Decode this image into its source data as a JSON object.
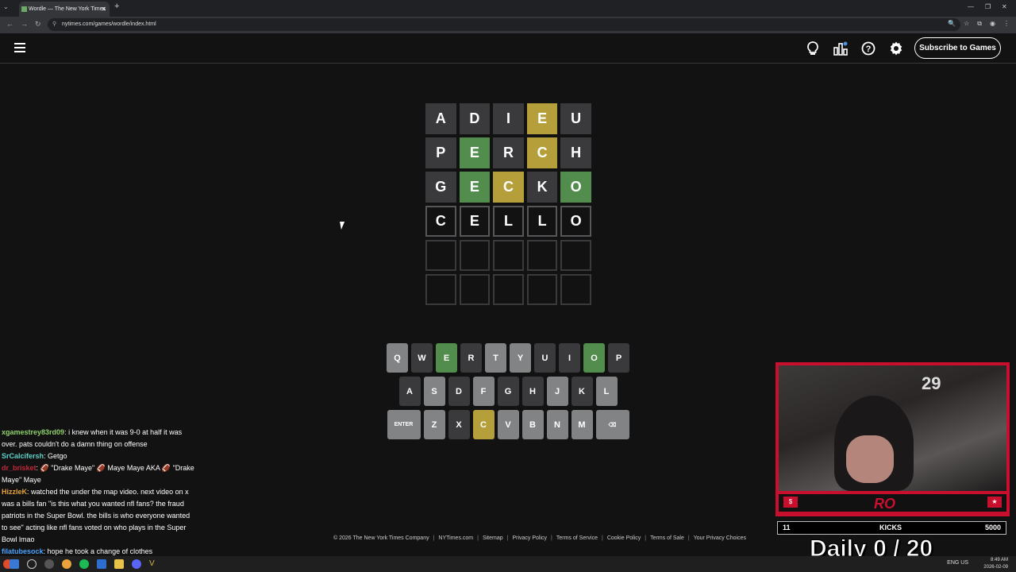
{
  "browser": {
    "tab_title": "Wordle — The New York Times",
    "url": "nytimes.com/games/wordle/index.html"
  },
  "header": {
    "subscribe_label": "Subscribe to Games",
    "icons": [
      "menu-icon",
      "hint-bulb-icon",
      "stats-icon",
      "help-icon",
      "settings-icon"
    ]
  },
  "board": {
    "rows": [
      [
        {
          "l": "A",
          "s": "absent"
        },
        {
          "l": "D",
          "s": "absent"
        },
        {
          "l": "I",
          "s": "absent"
        },
        {
          "l": "E",
          "s": "present"
        },
        {
          "l": "U",
          "s": "absent"
        }
      ],
      [
        {
          "l": "P",
          "s": "absent"
        },
        {
          "l": "E",
          "s": "correct"
        },
        {
          "l": "R",
          "s": "absent"
        },
        {
          "l": "C",
          "s": "present"
        },
        {
          "l": "H",
          "s": "absent"
        }
      ],
      [
        {
          "l": "G",
          "s": "absent"
        },
        {
          "l": "E",
          "s": "correct"
        },
        {
          "l": "C",
          "s": "present"
        },
        {
          "l": "K",
          "s": "absent"
        },
        {
          "l": "O",
          "s": "correct"
        }
      ],
      [
        {
          "l": "C",
          "s": "tbd"
        },
        {
          "l": "E",
          "s": "tbd"
        },
        {
          "l": "L",
          "s": "tbd"
        },
        {
          "l": "L",
          "s": "tbd"
        },
        {
          "l": "O",
          "s": "tbd"
        }
      ],
      [
        {
          "l": "",
          "s": "empty"
        },
        {
          "l": "",
          "s": "empty"
        },
        {
          "l": "",
          "s": "empty"
        },
        {
          "l": "",
          "s": "empty"
        },
        {
          "l": "",
          "s": "empty"
        }
      ],
      [
        {
          "l": "",
          "s": "empty"
        },
        {
          "l": "",
          "s": "empty"
        },
        {
          "l": "",
          "s": "empty"
        },
        {
          "l": "",
          "s": "empty"
        },
        {
          "l": "",
          "s": "empty"
        }
      ]
    ]
  },
  "keyboard": {
    "rows": [
      [
        {
          "k": "Q",
          "s": "unused"
        },
        {
          "k": "W",
          "s": "absent"
        },
        {
          "k": "E",
          "s": "correct"
        },
        {
          "k": "R",
          "s": "absent"
        },
        {
          "k": "T",
          "s": "unused"
        },
        {
          "k": "Y",
          "s": "unused"
        },
        {
          "k": "U",
          "s": "absent"
        },
        {
          "k": "I",
          "s": "absent"
        },
        {
          "k": "O",
          "s": "correct"
        },
        {
          "k": "P",
          "s": "absent"
        }
      ],
      [
        {
          "k": "A",
          "s": "absent"
        },
        {
          "k": "S",
          "s": "unused"
        },
        {
          "k": "D",
          "s": "absent"
        },
        {
          "k": "F",
          "s": "unused"
        },
        {
          "k": "G",
          "s": "absent"
        },
        {
          "k": "H",
          "s": "absent"
        },
        {
          "k": "J",
          "s": "unused"
        },
        {
          "k": "K",
          "s": "absent"
        },
        {
          "k": "L",
          "s": "unused"
        }
      ],
      [
        {
          "k": "ENTER",
          "s": "unused",
          "wide": true
        },
        {
          "k": "Z",
          "s": "unused"
        },
        {
          "k": "X",
          "s": "absent"
        },
        {
          "k": "C",
          "s": "present"
        },
        {
          "k": "V",
          "s": "unused"
        },
        {
          "k": "B",
          "s": "unused"
        },
        {
          "k": "N",
          "s": "unused"
        },
        {
          "k": "M",
          "s": "unused"
        },
        {
          "k": "⌫",
          "s": "unused",
          "wide": true
        }
      ]
    ]
  },
  "footer": [
    "© 2026 The New York Times Company",
    "NYTimes.com",
    "Sitemap",
    "Privacy Policy",
    "Terms of Service",
    "Cookie Policy",
    "Terms of Sale",
    "Your Privacy Choices"
  ],
  "chat": [
    {
      "name": "xgamestrey83rd09",
      "color": "#8fd16a",
      "text": ": i knew when it was 9-0 at half it was over. pats couldn't do a damn thing on offense"
    },
    {
      "name": "SrCalcifersh",
      "color": "#5fd2c8",
      "text": ": Getgo"
    },
    {
      "name": "dr_brisket",
      "color": "#c0283a",
      "text": ": 🏈 \"Drake Maye\" 🏈 Maye Maye AKA 🏈 \"Drake Maye\" Maye"
    },
    {
      "name": "HizzleK",
      "color": "#e8a33a",
      "text": ": watched the under the map video. next video on x was a bills fan \"is this what you wanted nfl fans? the fraud patriots in the Super Bowl. the bills is who everyone wanted to see\" acting like nfl fans voted on who plays in the Super Bowl lmao"
    },
    {
      "name": "filatubesock",
      "color": "#4aa3ff",
      "text": ": hope he took a change of clothes"
    }
  ],
  "stream": {
    "logo": "RO",
    "kicks_left": "11",
    "kicks_label": "KICKS",
    "kicks_right": "5000",
    "daily_label": "Daily",
    "daily_count": "0 / 20",
    "jersey_number": "29"
  },
  "taskbar": {
    "time": "8:49 AM",
    "date": "2026-02-09",
    "lang": "ENG US"
  },
  "colors": {
    "correct": "#538d4e",
    "present": "#b59f3b",
    "absent": "#3a3a3c",
    "unused": "#818384",
    "background": "#121213"
  }
}
